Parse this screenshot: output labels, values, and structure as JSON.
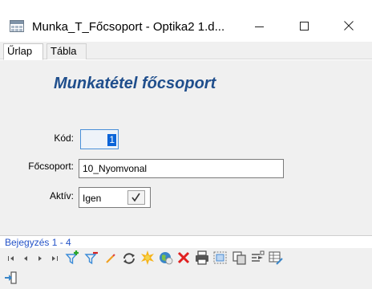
{
  "window": {
    "title": "Munka_T_Főcsoport - Optika2 1.d...",
    "minimize_glyph": "—",
    "maximize_glyph": "☐",
    "close_glyph": "✕"
  },
  "tabs": [
    {
      "label": "Űrlap",
      "active": true
    },
    {
      "label": "Tábla",
      "active": false
    }
  ],
  "form": {
    "title": "Munkatétel főcsoport",
    "fields": {
      "kod": {
        "label": "Kód:",
        "value": "1"
      },
      "focsoport": {
        "label": "Főcsoport:",
        "value": "10_Nyomvonal"
      },
      "aktiv": {
        "label": "Aktív:",
        "value": "Igen",
        "check_glyph": "✓"
      }
    }
  },
  "status": {
    "text": "Bejegyzés 1 - 4"
  },
  "toolbar": {
    "icons": [
      "first-record-icon",
      "previous-record-icon",
      "next-record-icon",
      "last-record-icon",
      "add-filter-icon",
      "remove-filter-icon",
      "edit-icon",
      "refresh-icon",
      "new-record-icon",
      "web-icon",
      "delete-icon",
      "print-icon",
      "select-icon",
      "copy-icon",
      "export-icon",
      "table-edit-icon",
      "exit-icon"
    ]
  },
  "colors": {
    "title_blue": "#1f4e8c",
    "status_blue": "#2453c8",
    "selection_blue": "#0a64d8",
    "form_background": "#f0f0f0"
  }
}
